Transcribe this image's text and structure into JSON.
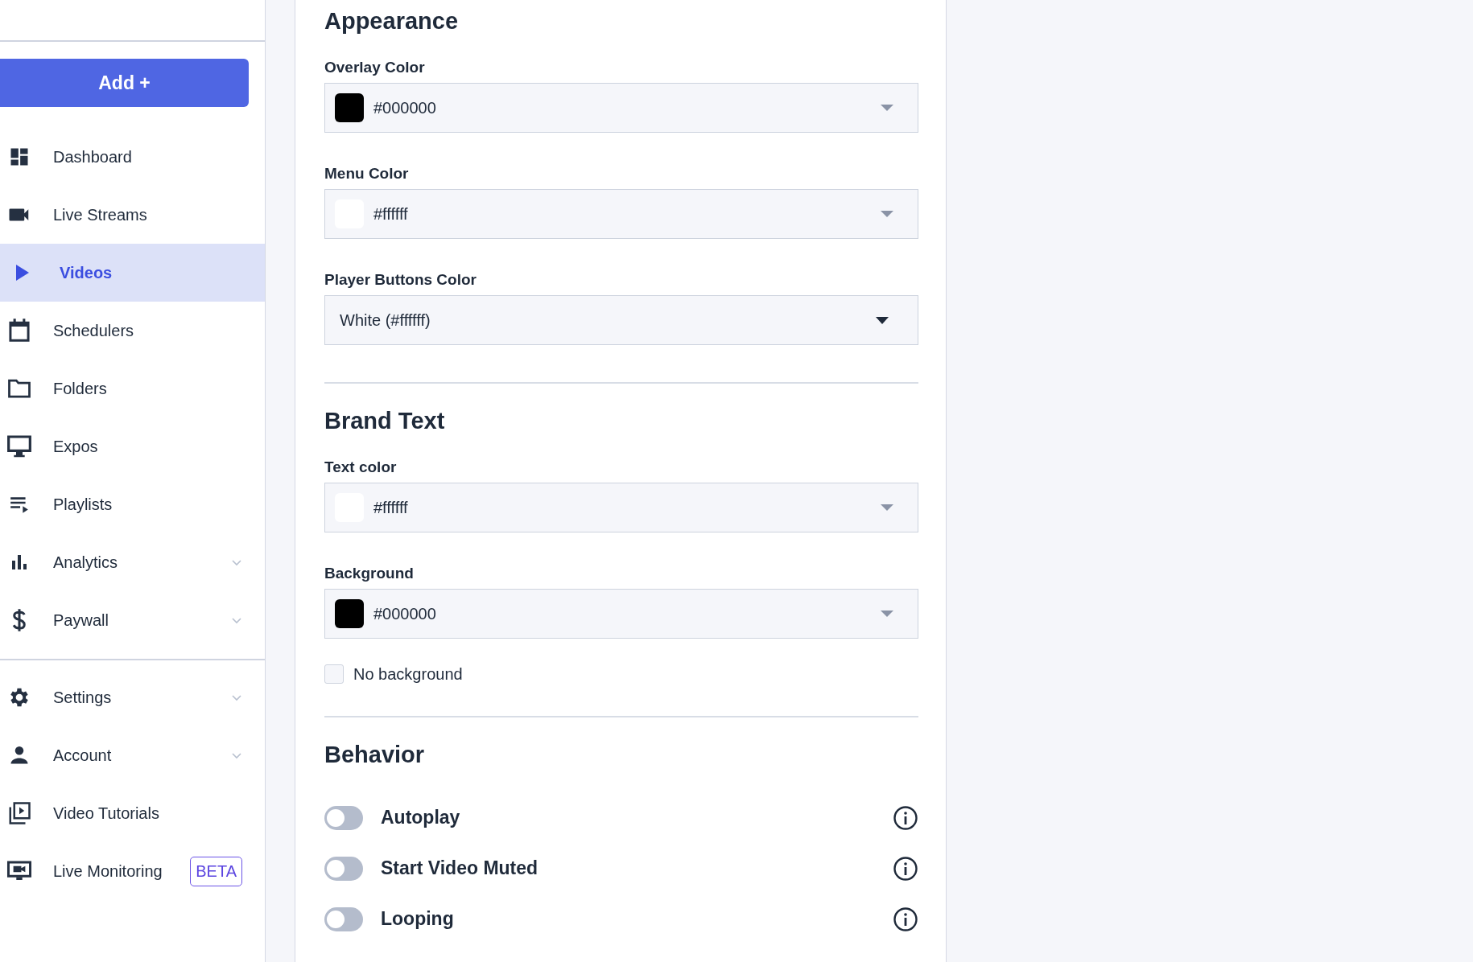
{
  "sidebar": {
    "add_button": "Add +",
    "groups": [
      [
        {
          "label": "Dashboard",
          "selected": false
        },
        {
          "label": "Live Streams",
          "selected": false
        },
        {
          "label": "Videos",
          "selected": true
        },
        {
          "label": "Schedulers",
          "selected": false
        },
        {
          "label": "Folders",
          "selected": false
        },
        {
          "label": "Expos",
          "selected": false
        },
        {
          "label": "Playlists",
          "selected": false
        },
        {
          "label": "Analytics",
          "selected": false,
          "expanded": false
        },
        {
          "label": "Paywall",
          "selected": false,
          "expanded": false
        }
      ],
      [
        {
          "label": "Settings",
          "selected": false,
          "expanded": false
        },
        {
          "label": "Account",
          "selected": false,
          "expanded": false
        },
        {
          "label": "Video Tutorials",
          "selected": false
        },
        {
          "label": "Live Monitoring",
          "selected": false,
          "badge": "BETA"
        }
      ]
    ]
  },
  "sections": [
    {
      "heading": "Appearance",
      "fields": [
        {
          "kind": "color",
          "label": "Overlay Color",
          "value": "#000000",
          "color": "#000000"
        },
        {
          "kind": "color",
          "label": "Menu Color",
          "value": "#ffffff",
          "color": "#ffffff"
        },
        {
          "kind": "select",
          "label": "Player Buttons Color",
          "value": "White (#ffffff)"
        }
      ]
    },
    {
      "heading": "Brand Text",
      "fields": [
        {
          "kind": "color",
          "label": "Text color",
          "value": "#ffffff",
          "color": "#ffffff"
        },
        {
          "kind": "color",
          "label": "Background",
          "value": "#000000",
          "color": "#000000"
        },
        {
          "kind": "checkbox",
          "label": "No background",
          "checked": false
        }
      ]
    },
    {
      "heading": "Behavior",
      "fields": [
        {
          "kind": "toggle",
          "label": "Autoplay",
          "on": false
        },
        {
          "kind": "toggle",
          "label": "Start Video Muted",
          "on": false
        },
        {
          "kind": "toggle",
          "label": "Looping",
          "on": false
        }
      ]
    }
  ]
}
